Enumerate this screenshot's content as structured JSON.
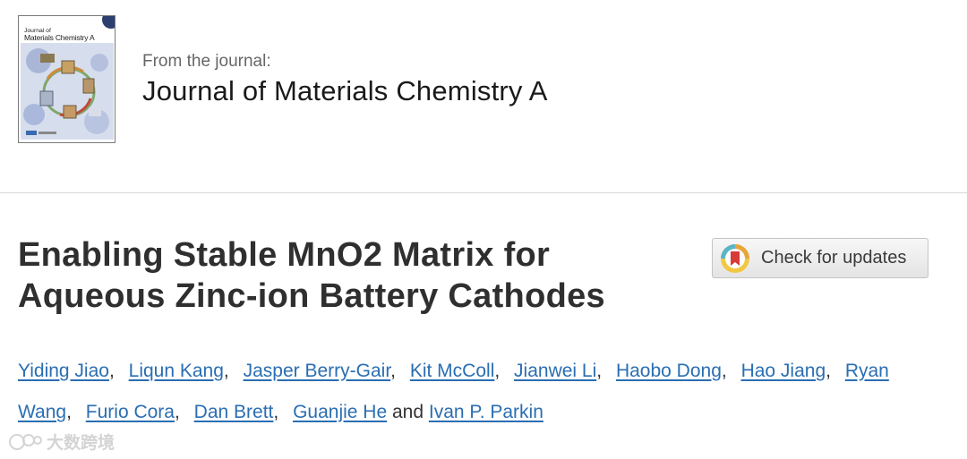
{
  "journal": {
    "cover_title_line1": "Journal of",
    "cover_title_line2": "Materials Chemistry A",
    "from_label": "From the journal:",
    "name": "Journal of Materials Chemistry A"
  },
  "article": {
    "title_line1": "Enabling Stable MnO2 Matrix for",
    "title_line2": "Aqueous Zinc-ion Battery Cathodes",
    "check_updates_label": "Check for updates",
    "authors_line1": [
      "Yiding Jiao",
      "Liqun Kang",
      "Jasper Berry-Gair",
      "Kit McColl",
      "Jianwei Li",
      "Haobo Dong",
      "Hao Jiang",
      "Ryan"
    ],
    "authors_line2": [
      "Wang",
      "Furio Cora",
      "Dan Brett",
      "Guanjie He"
    ],
    "conjunction": "and",
    "last_author": "Ivan P. Parkin"
  },
  "watermark": {
    "text": "大数跨境"
  },
  "colors": {
    "link": "#2a6eb2",
    "title": "#2f2f2f",
    "divider": "#d8d8d8"
  }
}
